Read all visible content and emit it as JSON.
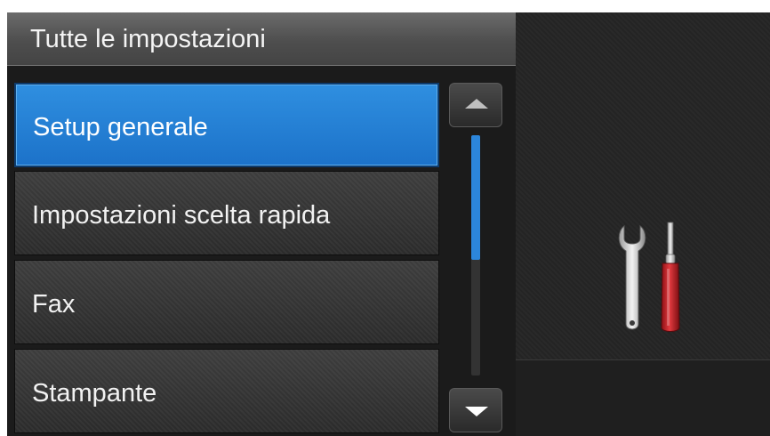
{
  "header": {
    "title": "Tutte le impostazioni"
  },
  "menu": {
    "items": [
      {
        "label": "Setup generale",
        "selected": true
      },
      {
        "label": "Impostazioni scelta rapida",
        "selected": false
      },
      {
        "label": "Fax",
        "selected": false
      },
      {
        "label": "Stampante",
        "selected": false
      }
    ]
  },
  "scrollbar": {
    "up_icon": "triangle-up-icon",
    "down_icon": "triangle-down-icon",
    "position_fraction": 0.0,
    "visible_fraction": 0.52
  },
  "preview": {
    "icon": "wrench-screwdriver-icon"
  },
  "colors": {
    "accent": "#2a85dc",
    "selected_item": "#2480d8",
    "screwdriver_handle": "#d8252b",
    "title_bar": "#5a5a5a"
  }
}
